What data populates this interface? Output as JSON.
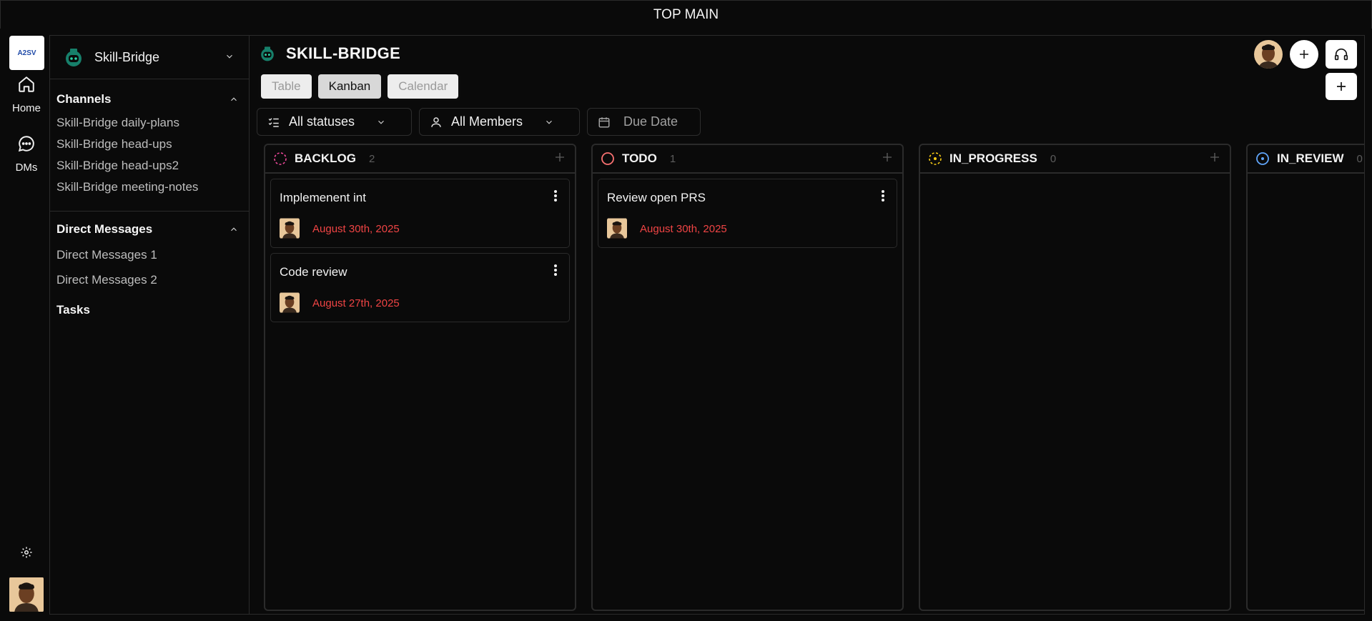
{
  "topbar": {
    "title": "TOP MAIN"
  },
  "rail": {
    "logo_text": "A2SV",
    "items": [
      {
        "label": "Home",
        "icon": "home-icon"
      },
      {
        "label": "DMs",
        "icon": "chat-icon"
      }
    ]
  },
  "sidebar": {
    "workspace": "Skill-Bridge",
    "channels_title": "Channels",
    "channels": [
      "Skill-Bridge daily-plans",
      "Skill-Bridge head-ups",
      "Skill-Bridge head-ups2",
      "Skill-Bridge meeting-notes"
    ],
    "dm_title": "Direct Messages",
    "dms": [
      "Direct Messages 1",
      "Direct Messages 2"
    ],
    "tasks_title": "Tasks"
  },
  "main": {
    "title": "SKILL-BRIDGE",
    "tabs": [
      {
        "label": "Table"
      },
      {
        "label": "Kanban",
        "active": true
      },
      {
        "label": "Calendar"
      }
    ],
    "filters": {
      "status": "All statuses",
      "members": "All Members",
      "due": "Due Date"
    },
    "columns": [
      {
        "title": "BACKLOG",
        "count": "2",
        "color": "#ec4899",
        "cards": [
          {
            "title": "Implemenent int",
            "date": "August 30th, 2025"
          },
          {
            "title": "Code review",
            "date": "August 27th, 2025"
          }
        ]
      },
      {
        "title": "TODO",
        "count": "1",
        "color": "#f87171",
        "cards": [
          {
            "title": "Review open PRS",
            "date": "August 30th, 2025"
          }
        ]
      },
      {
        "title": "IN_PROGRESS",
        "count": "0",
        "color": "#facc15",
        "cards": []
      },
      {
        "title": "IN_REVIEW",
        "count": "0",
        "color": "#60a5fa",
        "cards": []
      }
    ]
  },
  "colors": {
    "background": "#0a0a0a",
    "border": "#2b2b2b",
    "date": "#ef4444"
  }
}
